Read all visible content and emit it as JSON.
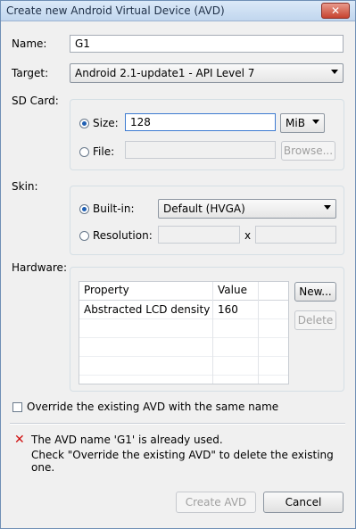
{
  "window": {
    "title": "Create new Android Virtual Device (AVD)",
    "close_glyph": "✕"
  },
  "form": {
    "name_label": "Name:",
    "name_value": "G1",
    "target_label": "Target:",
    "target_value": "Android 2.1-update1 - API Level 7"
  },
  "sdcard": {
    "label": "SD Card:",
    "size_label": "Size:",
    "size_value": "128",
    "unit_value": "MiB",
    "file_label": "File:",
    "browse_label": "Browse..."
  },
  "skin": {
    "label": "Skin:",
    "builtin_label": "Built-in:",
    "builtin_value": "Default (HVGA)",
    "resolution_label": "Resolution:",
    "x_label": "x"
  },
  "hardware": {
    "label": "Hardware:",
    "columns": [
      "Property",
      "Value"
    ],
    "rows": [
      {
        "property": "Abstracted LCD density",
        "value": "160"
      }
    ],
    "new_label": "New...",
    "delete_label": "Delete"
  },
  "override_label": "Override the existing AVD with the same name",
  "error": {
    "line1": "The AVD name 'G1' is already used.",
    "line2": "Check \"Override the existing AVD\" to delete the existing one."
  },
  "buttons": {
    "create_label": "Create AVD",
    "cancel_label": "Cancel"
  }
}
